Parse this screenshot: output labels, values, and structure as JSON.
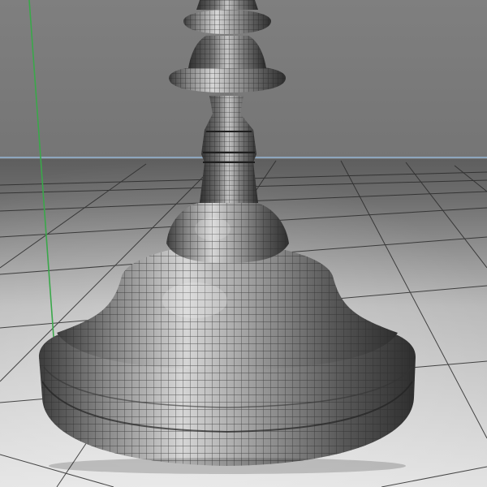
{
  "viewport": {
    "name": "3d-perspective-viewport",
    "colors": {
      "sky": "#7b7b7b",
      "floor_far": "#5c5c5c",
      "floor_near": "#d9d9d9",
      "horizon_line": "#8da6bd",
      "y_axis": "#3aa84a",
      "grid_line": "#2b2b2b",
      "wire": "#2a2a2a",
      "mesh_light": "#d2d2d2",
      "mesh_mid": "#8c8c8c",
      "mesh_dark": "#2e2e2e"
    },
    "object": {
      "name": "lathe-candlestick-mesh",
      "display_mode": "shaded-wireframe"
    }
  }
}
